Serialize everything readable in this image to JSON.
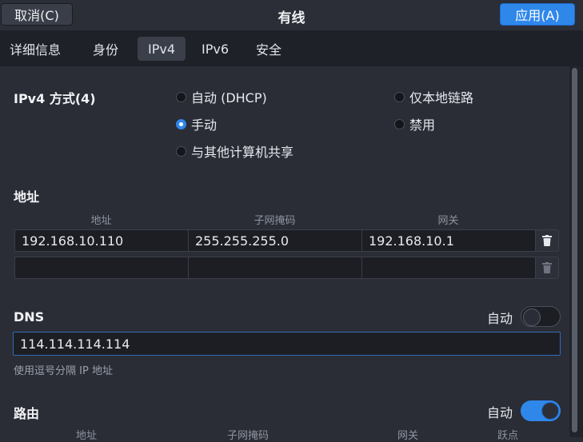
{
  "window": {
    "title": "有线"
  },
  "buttons": {
    "cancel": "取消(C)",
    "apply": "应用(A)"
  },
  "tabs": [
    {
      "label": "详细信息"
    },
    {
      "label": "身份"
    },
    {
      "label": "IPv4",
      "active": true
    },
    {
      "label": "IPv6"
    },
    {
      "label": "安全"
    }
  ],
  "ipv4_method": {
    "label": "IPv4 方式(4)",
    "options": [
      {
        "label": "自动 (DHCP)",
        "selected": false
      },
      {
        "label": "仅本地链路",
        "selected": false
      },
      {
        "label": "手动",
        "selected": true
      },
      {
        "label": "禁用",
        "selected": false
      },
      {
        "label": "与其他计算机共享",
        "selected": false
      }
    ]
  },
  "addresses": {
    "section_label": "地址",
    "headers": [
      "地址",
      "子网掩码",
      "网关"
    ],
    "rows": [
      {
        "address": "192.168.10.110",
        "netmask": "255.255.255.0",
        "gateway": "192.168.10.1"
      },
      {
        "address": "",
        "netmask": "",
        "gateway": ""
      }
    ]
  },
  "dns": {
    "label": "DNS",
    "auto_label": "自动",
    "auto": false,
    "value": "114.114.114.114",
    "hint": "使用逗号分隔 IP 地址"
  },
  "routes": {
    "label": "路由",
    "auto_label": "自动",
    "auto": true,
    "headers": [
      "地址",
      "子网掩码",
      "网关",
      "跃点"
    ]
  },
  "colors": {
    "accent": "#2f87ea",
    "background": "#2a2d36",
    "tabbar": "#1f2128"
  }
}
